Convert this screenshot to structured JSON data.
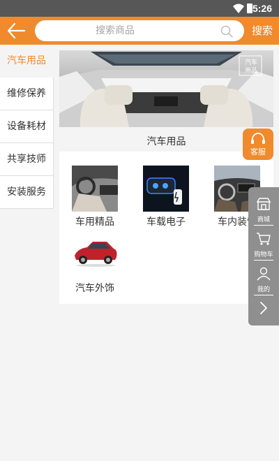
{
  "status_bar": {
    "time": "5:26"
  },
  "header": {
    "search_placeholder": "搜索商品",
    "search_button": "搜索"
  },
  "sidebar": {
    "items": [
      {
        "label": "汽车用品",
        "active": true
      },
      {
        "label": "维修保养",
        "active": false
      },
      {
        "label": "设备耗材",
        "active": false
      },
      {
        "label": "共享技师",
        "active": false
      },
      {
        "label": "安装服务",
        "active": false
      }
    ]
  },
  "main": {
    "banner_watermark": [
      "汽车",
      "用品"
    ],
    "category_title": "汽车用品",
    "subcategories": [
      {
        "label": "车用精品",
        "icon": "car-interior-photo"
      },
      {
        "label": "车载电子",
        "icon": "car-charger-photo"
      },
      {
        "label": "车内装饰",
        "icon": "dashboard-photo"
      },
      {
        "label": "汽车外饰",
        "icon": "red-car-photo"
      }
    ]
  },
  "customer_service": {
    "label": "客服",
    "icon": "headset-icon"
  },
  "float_toolbar": {
    "items": [
      {
        "label": "商城",
        "icon": "store-icon"
      },
      {
        "label": "购物车",
        "icon": "cart-icon"
      },
      {
        "label": "我的",
        "icon": "user-icon"
      }
    ],
    "expand_icon": "chevron-right-icon"
  },
  "colors": {
    "accent": "#f08a2c",
    "status_bar": "#575757",
    "float_toolbar": "#8f8f8f",
    "background": "#f4f4f4"
  }
}
